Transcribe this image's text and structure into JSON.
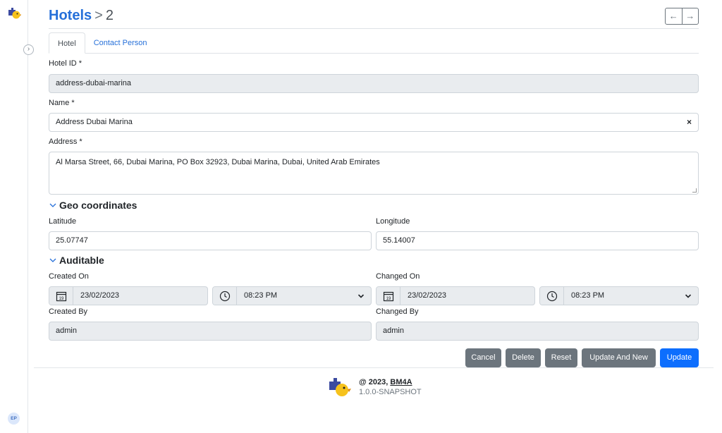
{
  "breadcrumb": {
    "parent": "Hotels",
    "separator": ">",
    "current": "2"
  },
  "nav": {
    "prev_icon": "arrow-left-icon",
    "next_icon": "arrow-right-icon",
    "prev": "←",
    "next": "→"
  },
  "tabs": [
    {
      "label": "Hotel",
      "active": true
    },
    {
      "label": "Contact Person",
      "active": false
    }
  ],
  "form": {
    "hotel_id": {
      "label": "Hotel ID *",
      "value": "address-dubai-marina"
    },
    "name": {
      "label": "Name *",
      "value": "Address Dubai Marina",
      "clear": "×"
    },
    "address": {
      "label": "Address *",
      "value": "Al Marsa Street, 66, Dubai Marina, PO Box 32923, Dubai Marina, Dubai, United Arab Emirates"
    }
  },
  "geo": {
    "title": "Geo coordinates",
    "latitude": {
      "label": "Latitude",
      "value": "25.07747"
    },
    "longitude": {
      "label": "Longitude",
      "value": "55.14007"
    }
  },
  "auditable": {
    "title": "Auditable",
    "created_on": {
      "label": "Created On",
      "date": "23/02/2023",
      "time": "08:23 PM"
    },
    "changed_on": {
      "label": "Changed On",
      "date": "23/02/2023",
      "time": "08:23 PM"
    },
    "created_by": {
      "label": "Created By",
      "value": "admin"
    },
    "changed_by": {
      "label": "Changed By",
      "value": "admin"
    },
    "calendar_day": "19"
  },
  "buttons": {
    "cancel": "Cancel",
    "delete": "Delete",
    "reset": "Reset",
    "update_and_new": "Update And New",
    "update": "Update"
  },
  "footer": {
    "copyright": "@ 2023,",
    "brand": "BM4A",
    "version": "1.0.0-SNAPSHOT"
  },
  "user": {
    "initials": "EP"
  },
  "colors": {
    "accent": "#2670d9",
    "primary_button": "#0d6efd",
    "secondary_button": "#6c757d",
    "readonly_bg": "#e9ecef"
  }
}
